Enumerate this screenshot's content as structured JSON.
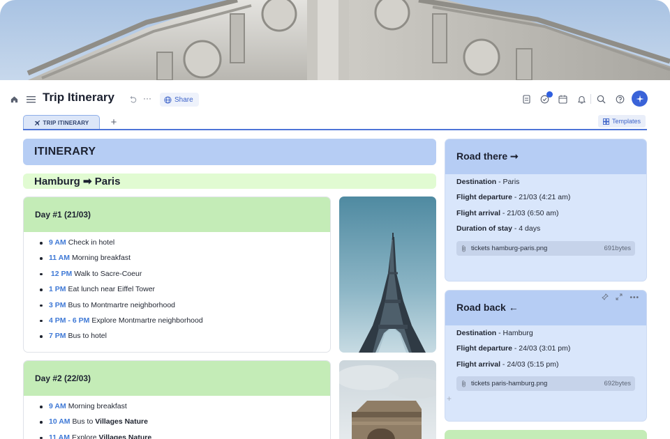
{
  "header": {
    "title": "Trip Itinerary",
    "share_label": "Share"
  },
  "tabs": [
    {
      "label": "TRIP ITINERARY",
      "active": true
    }
  ],
  "templates_label": "Templates",
  "itinerary": {
    "heading": "ITINERARY",
    "route": "Hamburg ➡ Paris"
  },
  "days": [
    {
      "heading": "Day #1  (21/03)",
      "items": [
        {
          "time": "9 AM",
          "text": "Check in hotel"
        },
        {
          "time": "11 AM",
          "text": "Morning breakfast"
        },
        {
          "time": " 12 PM",
          "text": "Walk to Sacre-Coeur"
        },
        {
          "time": "1 PM",
          "text": "Eat lunch near Eiffel Tower"
        },
        {
          "time": "3 PM",
          "text": "Bus to Montmartre neighborhood"
        },
        {
          "time": "4 PM - 6 PM",
          "text": "Explore Montmartre neighborhood"
        },
        {
          "time": "7 PM",
          "text": "Bus to hotel"
        }
      ]
    },
    {
      "heading": "Day #2  (22/03)",
      "items": [
        {
          "time": "9 AM",
          "text": "Morning breakfast",
          "bold": ""
        },
        {
          "time": "10 AM",
          "text": "Bus to ",
          "bold": "Villages Nature"
        },
        {
          "time": "11 AM",
          "text": "Explore ",
          "bold": "Villages Nature"
        }
      ]
    }
  ],
  "road_there": {
    "heading": "Road there ➞",
    "rows": [
      {
        "key": "Destination",
        "value": " - Paris"
      },
      {
        "key": "Flight departure",
        "value": " - 21/03 (4:21 am)"
      },
      {
        "key": "Flight arrival",
        "value": " - 21/03 (6:50 am)"
      },
      {
        "key": "Duration of stay",
        "value": " - 4 days"
      }
    ],
    "attachment": {
      "name": "tickets hamburg-paris.png",
      "size": "691bytes"
    }
  },
  "road_back": {
    "heading": "Road back ←",
    "rows": [
      {
        "key": "Destination",
        "value": " - Hamburg"
      },
      {
        "key": "Flight departure",
        "value": " - 24/03 (3:01 pm)"
      },
      {
        "key": "Flight arrival",
        "value": " - 24/03 (5:15 pm)"
      }
    ],
    "attachment": {
      "name": "tickets paris-hamburg.png",
      "size": "692bytes"
    }
  },
  "icons": {
    "home": "home-icon",
    "menu": "hamburger-menu-icon",
    "undo": "undo-icon",
    "more": "more-dots-icon",
    "globe": "globe-icon",
    "doc": "document-icon",
    "tasks": "check-circle-icon",
    "calendar": "calendar-icon",
    "bell": "bell-icon",
    "search": "search-icon",
    "help": "help-icon",
    "paperclip": "paperclip-icon"
  },
  "colors": {
    "accent": "#3a63d8",
    "blue_header": "#b6cdf4",
    "green_header": "#c4ecb7",
    "time_blue": "#3f79d6"
  }
}
